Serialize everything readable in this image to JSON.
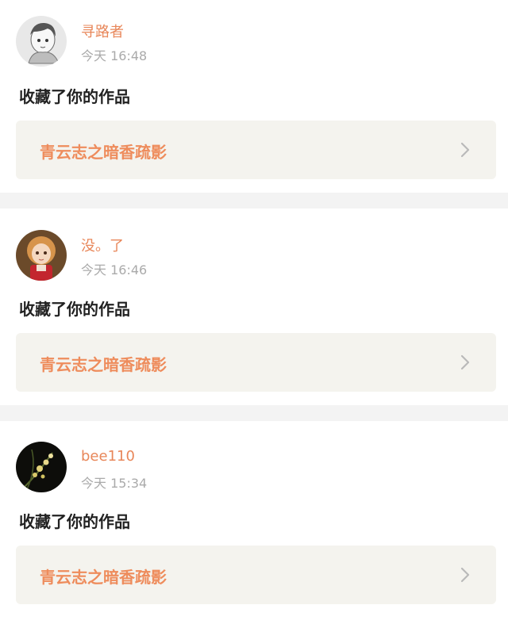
{
  "items": [
    {
      "user": "寻路者",
      "time": "今天 16:48",
      "action": "收藏了你的作品",
      "work": "青云志之暗香疏影",
      "avatar_icon": "anime-boy-avatar"
    },
    {
      "user": "没。了",
      "time": "今天 16:46",
      "action": "收藏了你的作品",
      "work": "青云志之暗香疏影",
      "avatar_icon": "doll-avatar"
    },
    {
      "user": "bee110",
      "time": "今天 15:34",
      "action": "收藏了你的作品",
      "work": "青云志之暗香疏影",
      "avatar_icon": "orchid-avatar"
    }
  ],
  "colors": {
    "username": "#e8875a",
    "work_title": "#ee8c5c",
    "timestamp": "#aaaaaa",
    "work_card_bg": "#f4f3ee",
    "separator_bg": "#f3f3f3"
  }
}
